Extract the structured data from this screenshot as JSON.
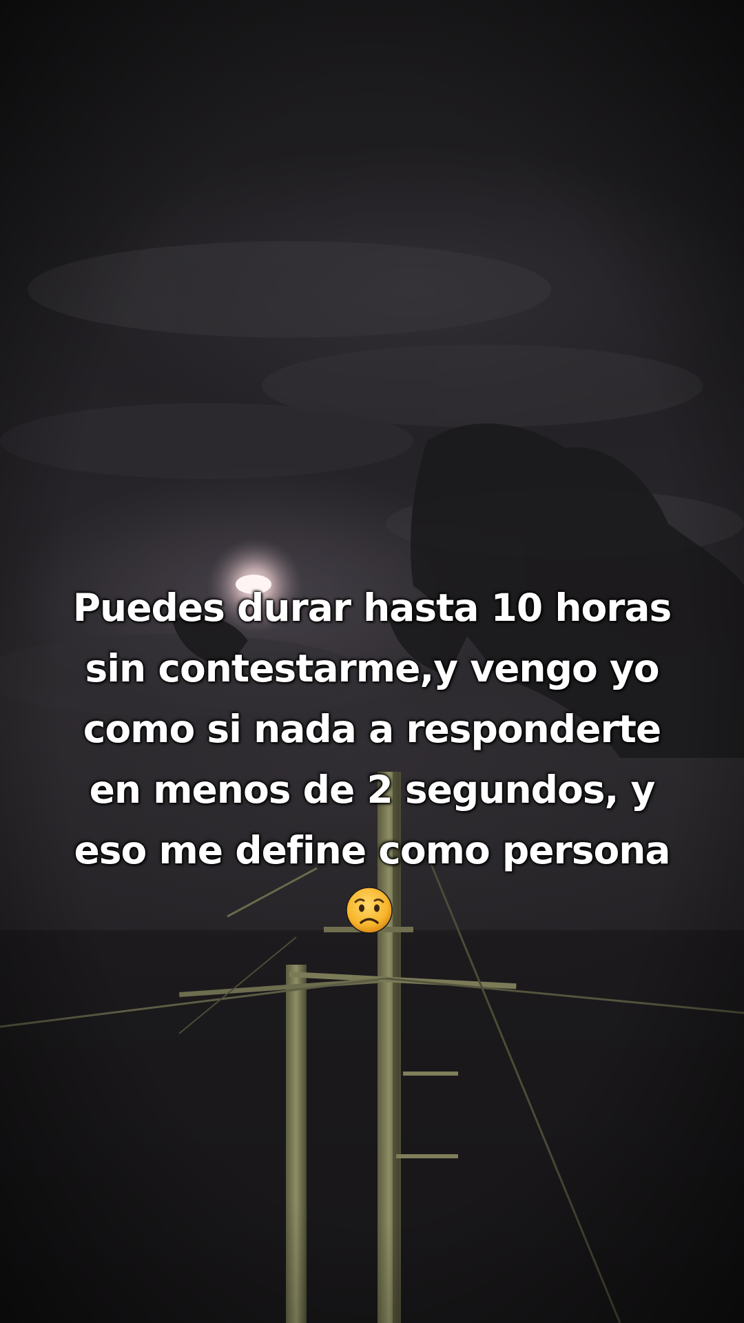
{
  "caption": {
    "lines": [
      "Puedes durar hasta 10 horas",
      "sin contestarme,y vengo yo",
      "como si nada a responderte",
      "en menos de 2 segundos, y",
      "eso me define como persona"
    ]
  },
  "emoji": {
    "icon": "worried-face-icon"
  },
  "colors": {
    "text": "#ffffff",
    "sky": "#252327",
    "moon": "#f3dcdc",
    "pole": "#8a8a62"
  }
}
